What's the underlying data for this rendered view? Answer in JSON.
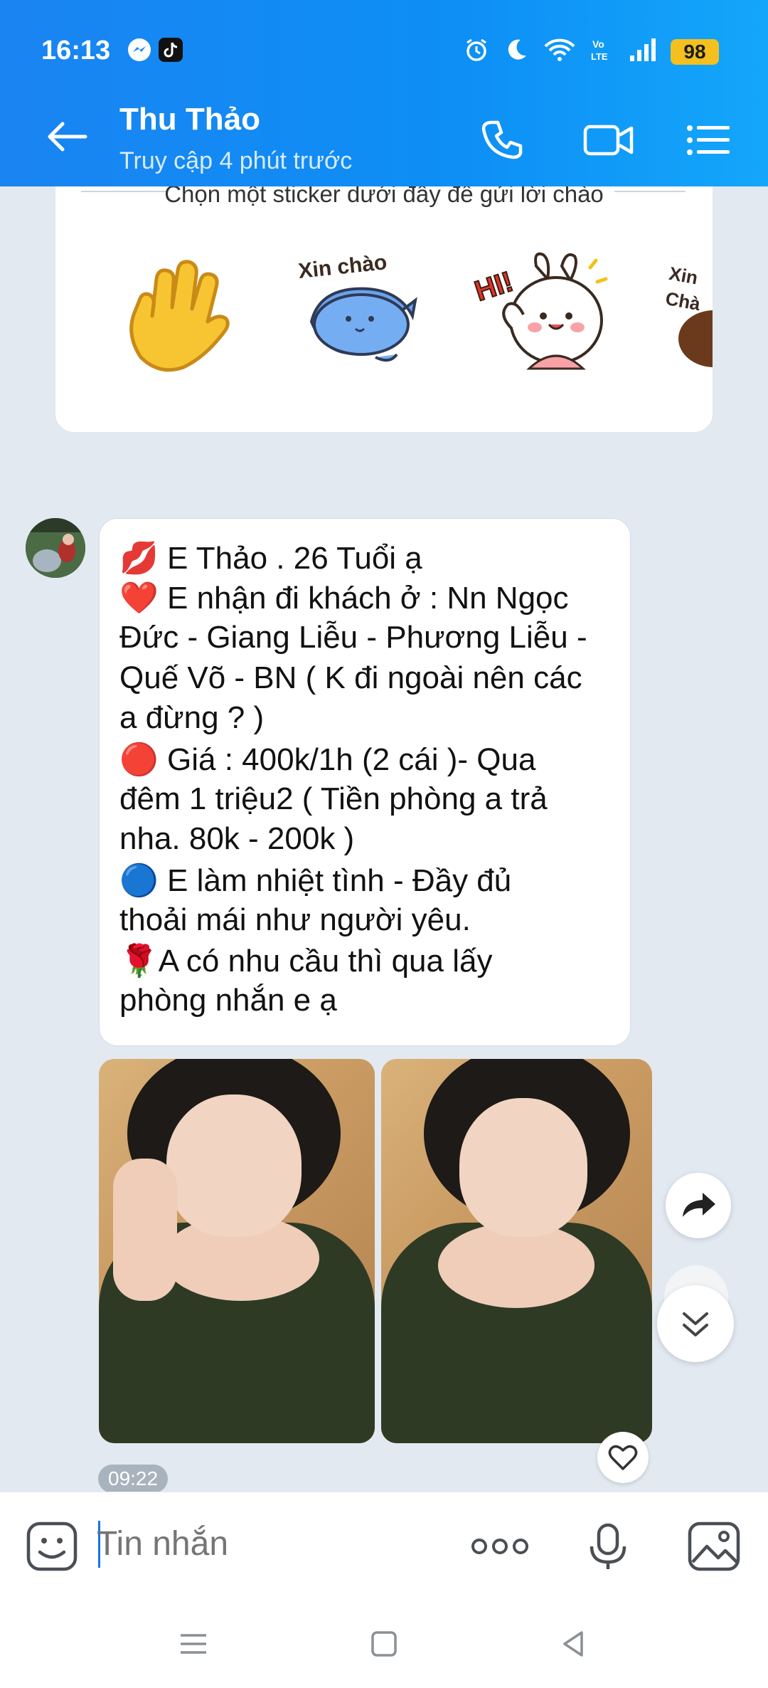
{
  "status_bar": {
    "time": "16:13",
    "battery": "98"
  },
  "header": {
    "title": "Thu Thảo",
    "subtitle": "Truy cập 4 phút trước"
  },
  "sticker_panel": {
    "hint": "Chọn một sticker dưới đây để gửi lời chào",
    "stickers": [
      {
        "name": "waving-hand"
      },
      {
        "name": "xin-chao-cat",
        "text": "Xin chào"
      },
      {
        "name": "hi-bunny",
        "text": "HI!"
      },
      {
        "name": "xin-chao-partial",
        "text": "Xin Chà"
      }
    ]
  },
  "message": {
    "lines": [
      "💋 E Thảo . 26 Tuổi ạ",
      "❤️  E nhận đi khách ở : Nn Ngọc",
      "Đức - Giang Liễu - Phương Liễu -",
      "Quế Võ - BN ( K đi ngoài nên các",
      "a đừng ?  )",
      "🔴 Giá : 400k/1h (2 cái )- Qua",
      "đêm 1 triệu2 ( Tiền phòng a trả",
      "nha. 80k - 200k )",
      "🔵  E làm nhiệt tình -  Đầy đủ",
      "thoải mái như người yêu.",
      " 🌹A có nhu cầu thì qua lấy",
      "phòng nhắn e ạ"
    ],
    "time": "09:22"
  },
  "input": {
    "placeholder": "Tin nhắn"
  },
  "colors": {
    "header": "#1a84f2",
    "chat_background": "#e2e9f1",
    "bubble": "#ffffff",
    "accent": "#1673e6"
  }
}
